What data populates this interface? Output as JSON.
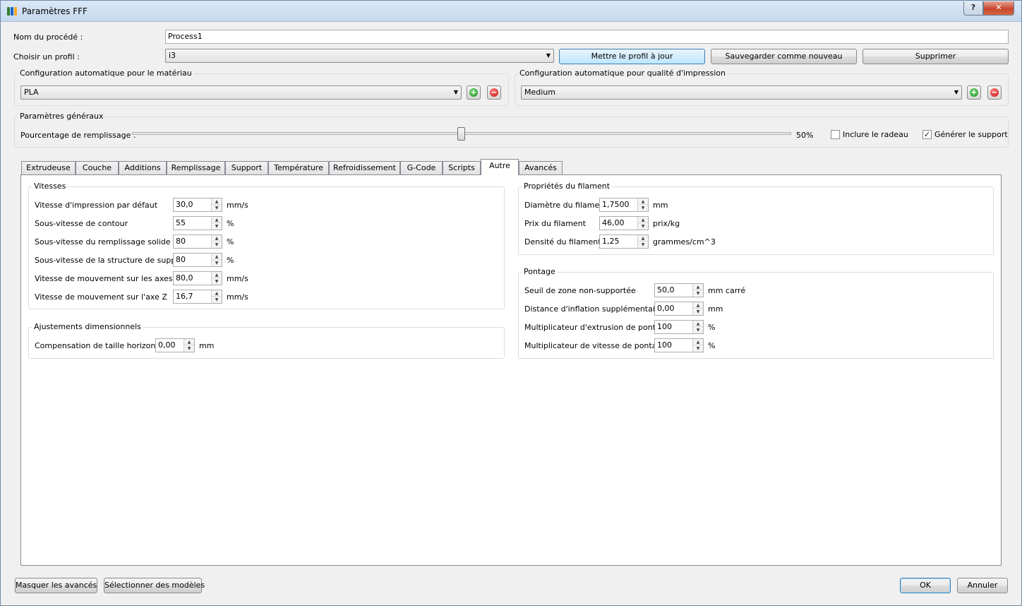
{
  "window": {
    "title": "Paramètres FFF",
    "help_glyph": "?",
    "close_glyph": "✕"
  },
  "process": {
    "name_label": "Nom du procédé :",
    "name_value": "Process1",
    "profile_label": "Choisir un profil :",
    "profile_value": "i3",
    "update_label": "Mettre le profil à jour",
    "save_new_label": "Sauvegarder comme nouveau",
    "delete_label": "Supprimer"
  },
  "material": {
    "title": "Configuration automatique pour le matériau",
    "value": "PLA"
  },
  "quality": {
    "title": "Configuration automatique pour qualité d'impression",
    "value": "Medium"
  },
  "general": {
    "title": "Paramètres généraux",
    "infill_label": "Pourcentage de remplissage :",
    "infill_value_text": "50%",
    "infill_fraction": 0.5,
    "raft_label": "Inclure le radeau",
    "raft_checked": false,
    "support_label": "Générer le support",
    "support_checked": true,
    "check_glyph": "✓"
  },
  "tabs": [
    {
      "label": "Extrudeuse"
    },
    {
      "label": "Couche"
    },
    {
      "label": "Additions"
    },
    {
      "label": "Remplissage"
    },
    {
      "label": "Support"
    },
    {
      "label": "Température"
    },
    {
      "label": "Refroidissement"
    },
    {
      "label": "G-Code"
    },
    {
      "label": "Scripts"
    },
    {
      "label": "Autre"
    },
    {
      "label": "Avancés"
    }
  ],
  "active_tab": "Autre",
  "speeds": {
    "title": "Vitesses",
    "rows": [
      {
        "label": "Vitesse d'impression par défaut",
        "value": "30,0",
        "unit": "mm/s"
      },
      {
        "label": "Sous-vitesse de contour",
        "value": "55",
        "unit": "%"
      },
      {
        "label": "Sous-vitesse du remplissage solide",
        "value": "80",
        "unit": "%"
      },
      {
        "label": "Sous-vitesse de la structure de support",
        "value": "80",
        "unit": "%"
      },
      {
        "label": "Vitesse de mouvement sur les axes X/Y",
        "value": "80,0",
        "unit": "mm/s"
      },
      {
        "label": "Vitesse de mouvement sur l'axe Z",
        "value": "16,7",
        "unit": "mm/s"
      }
    ]
  },
  "dimensional": {
    "title": "Ajustements dimensionnels",
    "rows": [
      {
        "label": "Compensation de taille horizontale",
        "value": "0,00",
        "unit": "mm"
      }
    ]
  },
  "filament": {
    "title": "Propriétés du filament",
    "rows": [
      {
        "label": "Diamètre du filament",
        "value": "1,7500",
        "unit": "mm"
      },
      {
        "label": "Prix du filament",
        "value": "46,00",
        "unit": "prix/kg"
      },
      {
        "label": "Densité du filament",
        "value": "1,25",
        "unit": "grammes/cm^3"
      }
    ]
  },
  "bridging": {
    "title": "Pontage",
    "rows": [
      {
        "label": "Seuil de zone non-supportée",
        "value": "50,0",
        "unit": "mm carré"
      },
      {
        "label": "Distance d'inflation supplémentaire",
        "value": "0,00",
        "unit": "mm"
      },
      {
        "label": "Multiplicateur d'extrusion de pontage",
        "value": "100",
        "unit": "%"
      },
      {
        "label": "Multiplicateur de vitesse de pontage",
        "value": "100",
        "unit": "%"
      }
    ]
  },
  "footer": {
    "hide_advanced_label": "Masquer les avancés",
    "select_models_label": "Sélectionner des modèles",
    "ok_label": "OK",
    "cancel_label": "Annuler"
  },
  "icons": {
    "combo_arrow": "▼",
    "spin_up": "▲",
    "spin_down": "▼",
    "add": "+",
    "remove": "−"
  },
  "colors": {
    "icon_bar_1": "#2e7d32",
    "icon_bar_2": "#1565c0",
    "icon_bar_3": "#f9a825"
  }
}
